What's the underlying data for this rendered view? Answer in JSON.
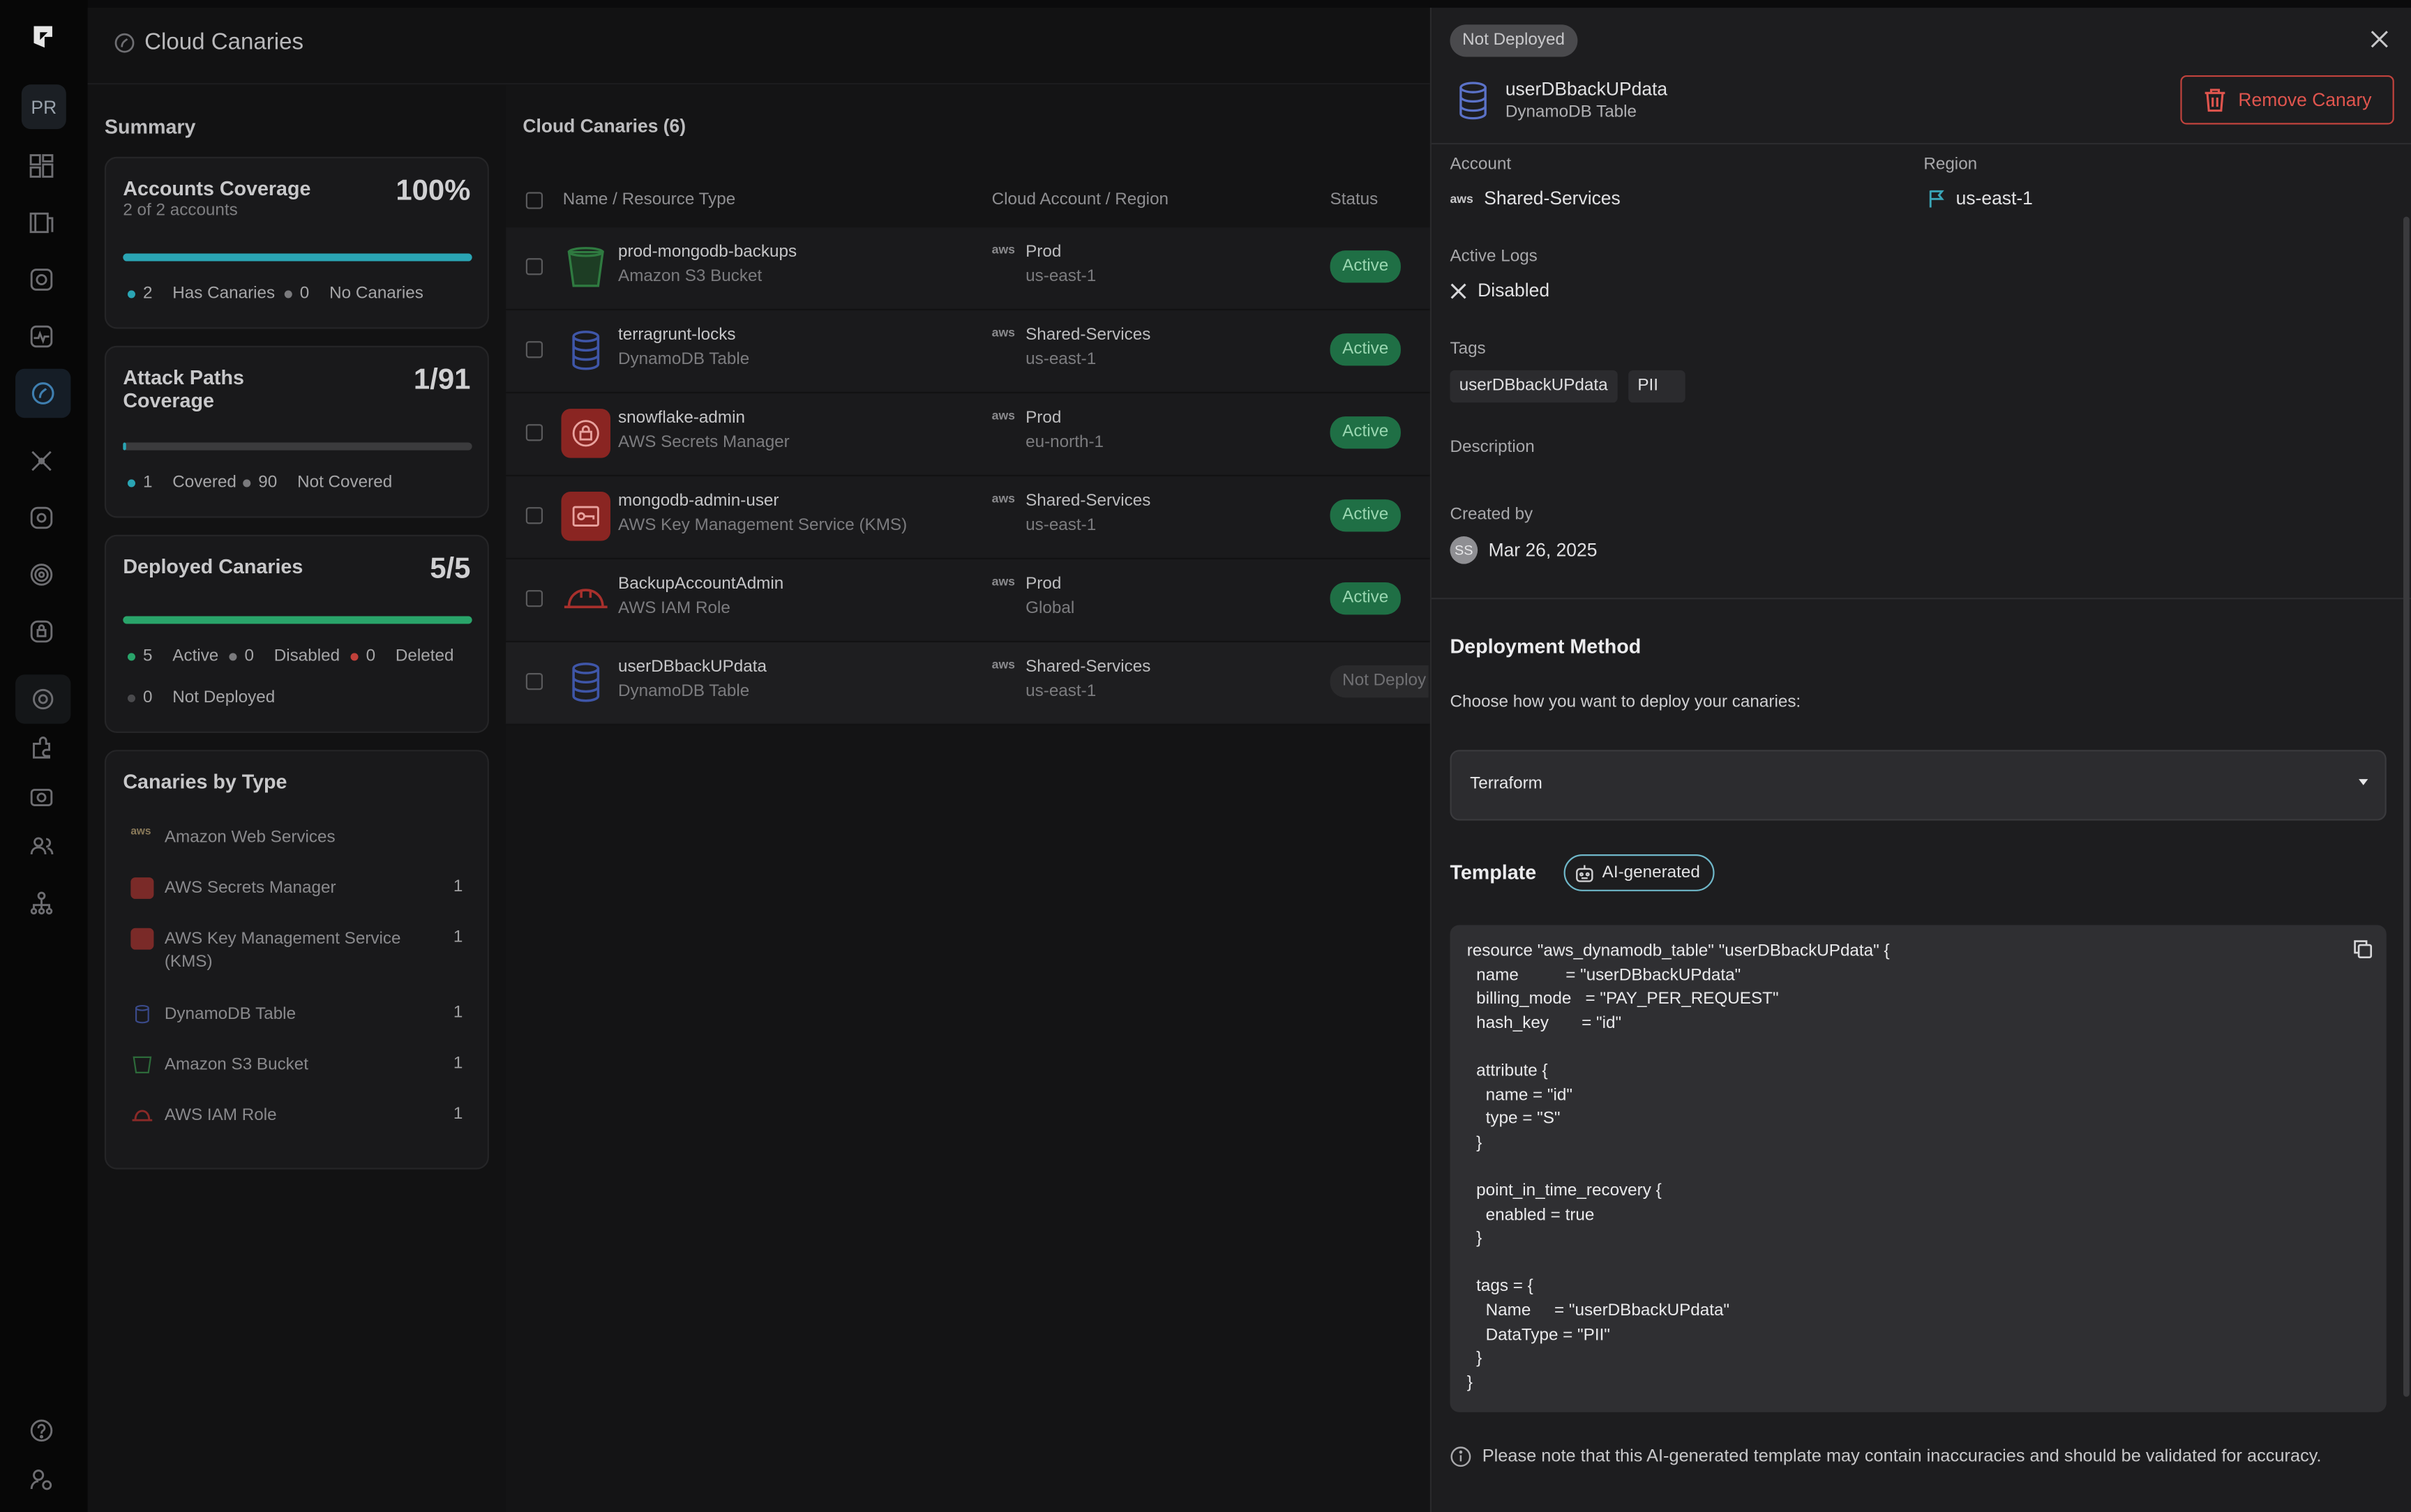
{
  "nav": {
    "workspace": "PR"
  },
  "page": {
    "title": "Cloud Canaries"
  },
  "summary": {
    "title": "Summary",
    "accounts": {
      "title": "Accounts Coverage",
      "subtitle": "2 of 2 accounts",
      "value": "100%",
      "fill": 1.0,
      "legend": [
        {
          "count": "2",
          "label": "Has Canaries",
          "color": "#2aa5b4"
        },
        {
          "count": "0",
          "label": "No Canaries",
          "color": "#7a7a7d"
        }
      ]
    },
    "attack": {
      "title": "Attack Paths Coverage",
      "value": "1/91",
      "fill": 0.011,
      "legend": [
        {
          "count": "1",
          "label": "Covered",
          "color": "#2aa5b4"
        },
        {
          "count": "90",
          "label": "Not Covered",
          "color": "#7a7a7d"
        }
      ]
    },
    "deployed": {
      "title": "Deployed Canaries",
      "value": "5/5",
      "fill": 1.0,
      "legend": [
        {
          "count": "5",
          "label": "Active",
          "color": "#29a46a"
        },
        {
          "count": "0",
          "label": "Disabled",
          "color": "#7a7a7d"
        },
        {
          "count": "0",
          "label": "Deleted",
          "color": "#c0403a"
        },
        {
          "count": "0",
          "label": "Not Deployed",
          "color": "#4a4a4d"
        }
      ]
    },
    "by_type": {
      "title": "Canaries by Type",
      "items": [
        {
          "label": "Amazon Web Services",
          "count": "",
          "icon": "aws-icon"
        },
        {
          "label": "AWS Secrets Manager",
          "count": "1",
          "icon": "secrets-manager-icon"
        },
        {
          "label": "AWS Key Management Service (KMS)",
          "count": "1",
          "icon": "kms-icon"
        },
        {
          "label": "DynamoDB Table",
          "count": "1",
          "icon": "dynamodb-icon"
        },
        {
          "label": "Amazon S3 Bucket",
          "count": "1",
          "icon": "s3-bucket-icon"
        },
        {
          "label": "AWS IAM Role",
          "count": "1",
          "icon": "iam-role-icon"
        }
      ]
    }
  },
  "table": {
    "title": "Cloud Canaries (6)",
    "headers": {
      "name": "Name / Resource Type",
      "account": "Cloud Account / Region",
      "status": "Status"
    },
    "rows": [
      {
        "name": "prod-mongodb-backups",
        "type": "Amazon S3 Bucket",
        "account": "Prod",
        "region": "us-east-1",
        "status": "Active",
        "icon": "s3-bucket-icon"
      },
      {
        "name": "terragrunt-locks",
        "type": "DynamoDB Table",
        "account": "Shared-Services",
        "region": "us-east-1",
        "status": "Active",
        "icon": "dynamodb-icon"
      },
      {
        "name": "snowflake-admin",
        "type": "AWS Secrets Manager",
        "account": "Prod",
        "region": "eu-north-1",
        "status": "Active",
        "icon": "secrets-manager-icon"
      },
      {
        "name": "mongodb-admin-user",
        "type": "AWS Key Management Service (KMS)",
        "account": "Shared-Services",
        "region": "us-east-1",
        "status": "Active",
        "icon": "kms-icon"
      },
      {
        "name": "BackupAccountAdmin",
        "type": "AWS IAM Role",
        "account": "Prod",
        "region": "Global",
        "status": "Active",
        "icon": "iam-role-icon"
      },
      {
        "name": "userDBbackUPdata",
        "type": "DynamoDB Table",
        "account": "Shared-Services",
        "region": "us-east-1",
        "status": "Not Deploy",
        "icon": "dynamodb-icon"
      }
    ],
    "aws_label": "aws"
  },
  "detail": {
    "status": "Not Deployed",
    "name": "userDBbackUPdata",
    "type": "DynamoDB Table",
    "remove_label": "Remove Canary",
    "account_label": "Account",
    "account": "Shared-Services",
    "region_label": "Region",
    "region": "us-east-1",
    "logs_label": "Active Logs",
    "logs": "Disabled",
    "tags_label": "Tags",
    "tags": [
      "userDBbackUPdata",
      "PII"
    ],
    "description_label": "Description",
    "created_label": "Created by",
    "created_initials": "SS",
    "created_date": "Mar 26, 2025",
    "deploy_title": "Deployment Method",
    "deploy_prompt": "Choose how you want to deploy your canaries:",
    "deploy_method": "Terraform",
    "template_title": "Template",
    "ai_badge": "AI-generated",
    "code": "resource \"aws_dynamodb_table\" \"userDBbackUPdata\" {\n  name          = \"userDBbackUPdata\"\n  billing_mode   = \"PAY_PER_REQUEST\"\n  hash_key       = \"id\"\n\n  attribute {\n    name = \"id\"\n    type = \"S\"\n  }\n\n  point_in_time_recovery {\n    enabled = true\n  }\n\n  tags = {\n    Name     = \"userDBbackUPdata\"\n    DataType = \"PII\"\n  }\n}",
    "note": "Please note that this AI-generated template may contain inaccuracies and should be validated for accuracy."
  },
  "colors": {
    "accent": "#2aa5b4",
    "active": "#1f6f45",
    "danger": "#c1433d"
  }
}
